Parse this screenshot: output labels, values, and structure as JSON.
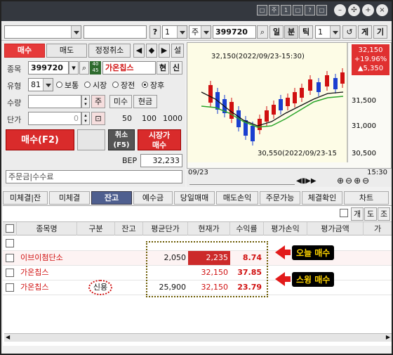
{
  "titlebar": {
    "buttons": [
      "□",
      "주",
      "1",
      "□",
      "?",
      "□"
    ]
  },
  "toolbar": {
    "question_btn": "?",
    "screen_num": "1",
    "stock_label": "주",
    "stock_code": "399720",
    "day_label": "일",
    "minute_label": "분",
    "tick_label": "틱",
    "period_value": "1",
    "ge_label": "게",
    "gi_label": "기"
  },
  "order": {
    "tabs": [
      "매수",
      "매도",
      "정정취소"
    ],
    "setting_label": "설",
    "code_label": "종목",
    "code_value": "399720",
    "badge": "40\n45",
    "stock_name": "가온칩스",
    "cash_credit": [
      "현",
      "신"
    ],
    "type_label": "유형",
    "type_value": "81",
    "radio_options": [
      "보통",
      "시장",
      "장전",
      "장후"
    ],
    "qty_label": "수량",
    "qty_unit": "주",
    "misu_label": "미수",
    "cash_label": "현금",
    "price_label": "단가",
    "price_value": "0",
    "price_steps": [
      "50",
      "100",
      "1000"
    ],
    "buy_button": "매수(F2)",
    "cancel_button": "취소\n(F5)",
    "market_button": "시장가\n매수",
    "bep_label": "BEP",
    "bep_value": "32,233",
    "footer_fields": [
      "주문금",
      "수수료"
    ]
  },
  "chart": {
    "price_box": "32,150\n+19.96%\n▲5,350",
    "high_annotation": "32,150(2022/09/23-15:30)",
    "low_annotation": "30,550(2022/09/23-15",
    "y_ticks": [
      "31,500",
      "31,000",
      "30,500"
    ],
    "x_labels": [
      "09/23",
      "15:30"
    ]
  },
  "bottom_tabs": [
    "미체결|잔",
    "미체결",
    "잔고",
    "예수금",
    "당일매매",
    "매도손익",
    "주문가능",
    "체결확인",
    "차트"
  ],
  "mini_toggles": [
    "개",
    "도",
    "조"
  ],
  "table": {
    "headers": [
      "종목명",
      "구분",
      "잔고",
      "평균단가",
      "현재가",
      "수익률",
      "평가손익",
      "평가금액",
      "가"
    ],
    "rows": [
      {
        "name": "",
        "type": "",
        "qty": "",
        "avg": "",
        "cur": "",
        "rate": ""
      },
      {
        "name": "이브이첨단소",
        "type": "",
        "qty": "",
        "avg": "2,050",
        "cur": "2,235",
        "rate": "8.74"
      },
      {
        "name": "가온칩스",
        "type": "",
        "qty": "",
        "avg": "",
        "cur": "32,150",
        "rate": "37.85"
      },
      {
        "name": "가온칩스",
        "type": "신용",
        "qty": "",
        "avg": "25,900",
        "cur": "32,150",
        "rate": "23.79"
      }
    ]
  },
  "annotations": {
    "today_buy": "오늘 매수",
    "swing_buy": "스윙 매수"
  },
  "colors": {
    "buy_red": "#d92b2b",
    "tab_active": "#4f5f8f",
    "annotation_yellow": "#ffd400"
  }
}
